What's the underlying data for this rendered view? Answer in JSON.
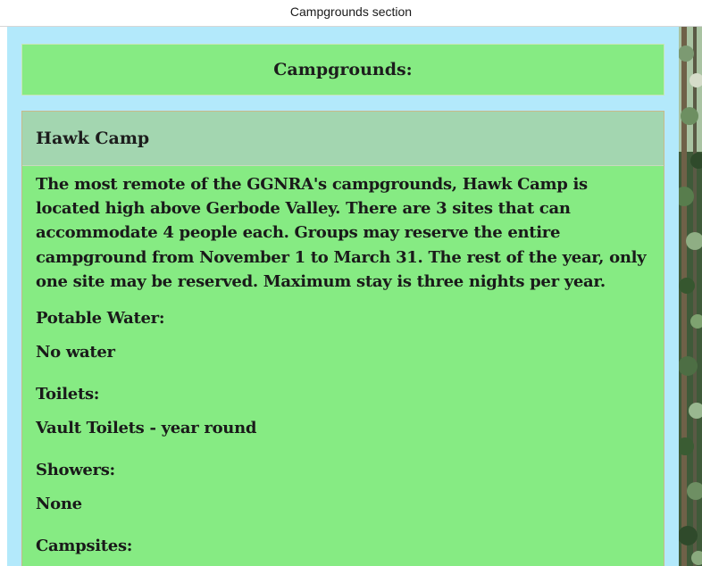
{
  "window": {
    "title": "Campgrounds section"
  },
  "section": {
    "heading": "Campgrounds:"
  },
  "camp": {
    "name": "Hawk Camp",
    "description": "The most remote of the GGNRA's campgrounds, Hawk Camp is located high above Gerbode Valley. There are 3 sites that can accommodate 4 people each. Groups may reserve the entire campground from November 1 to March 31. The rest of the year, only one site may be reserved. Maximum stay is three nights per year.",
    "fields": {
      "water_label": "Potable Water:",
      "water_value": "No water",
      "toilets_label": "Toilets:",
      "toilets_value": "Vault Toilets - year round",
      "showers_label": "Showers:",
      "showers_value": "None",
      "campsites_label": "Campsites:"
    }
  },
  "colors": {
    "page_background": "#b3e9fb",
    "panel_green": "#86eb83",
    "camp_header": "#a3d6b0"
  }
}
